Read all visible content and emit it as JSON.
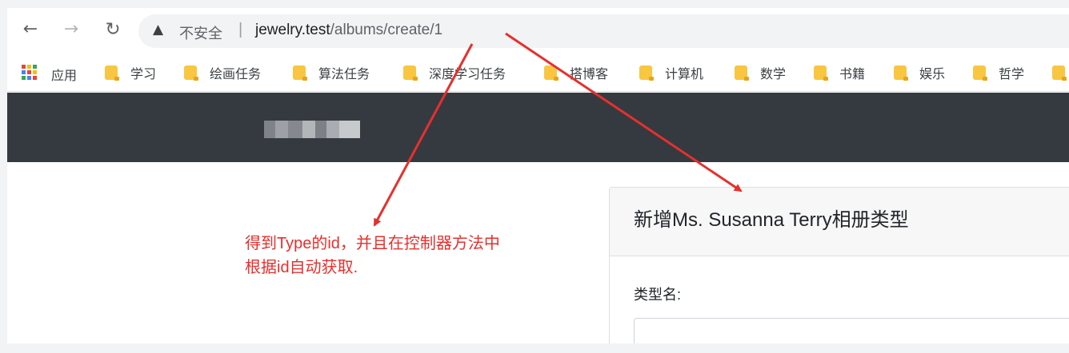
{
  "browser": {
    "nav": {
      "back_icon": "←",
      "forward_icon": "→",
      "reload_icon": "↻"
    },
    "address": {
      "warning_icon": "▲",
      "insecure_label": "不安全",
      "separator": "|",
      "url_host": "jewelry.test",
      "url_path": "/albums/create/1"
    },
    "bookmarks": {
      "apps_label": "应用",
      "items": [
        {
          "label": "学习"
        },
        {
          "label": "绘画任务"
        },
        {
          "label": "算法任务"
        },
        {
          "label": "深度学习任务"
        },
        {
          "label": "搭博客"
        },
        {
          "label": "计算机"
        },
        {
          "label": "数学"
        },
        {
          "label": "书籍"
        },
        {
          "label": "娱乐"
        },
        {
          "label": "哲学"
        }
      ]
    }
  },
  "page": {
    "card": {
      "title": "新增Ms. Susanna Terry相册类型",
      "field_label": "类型名:",
      "field_value": ""
    }
  },
  "annotation": {
    "line1": "得到Type的id，并且在控制器方法中",
    "line2": "根据id自动获取.",
    "color": "#e6302d"
  },
  "colors": {
    "navbar": "#343a40",
    "folder": "#f8c640",
    "apps_grid": [
      "#ea4335",
      "#fbbc05",
      "#34a853",
      "#4285f4"
    ]
  }
}
